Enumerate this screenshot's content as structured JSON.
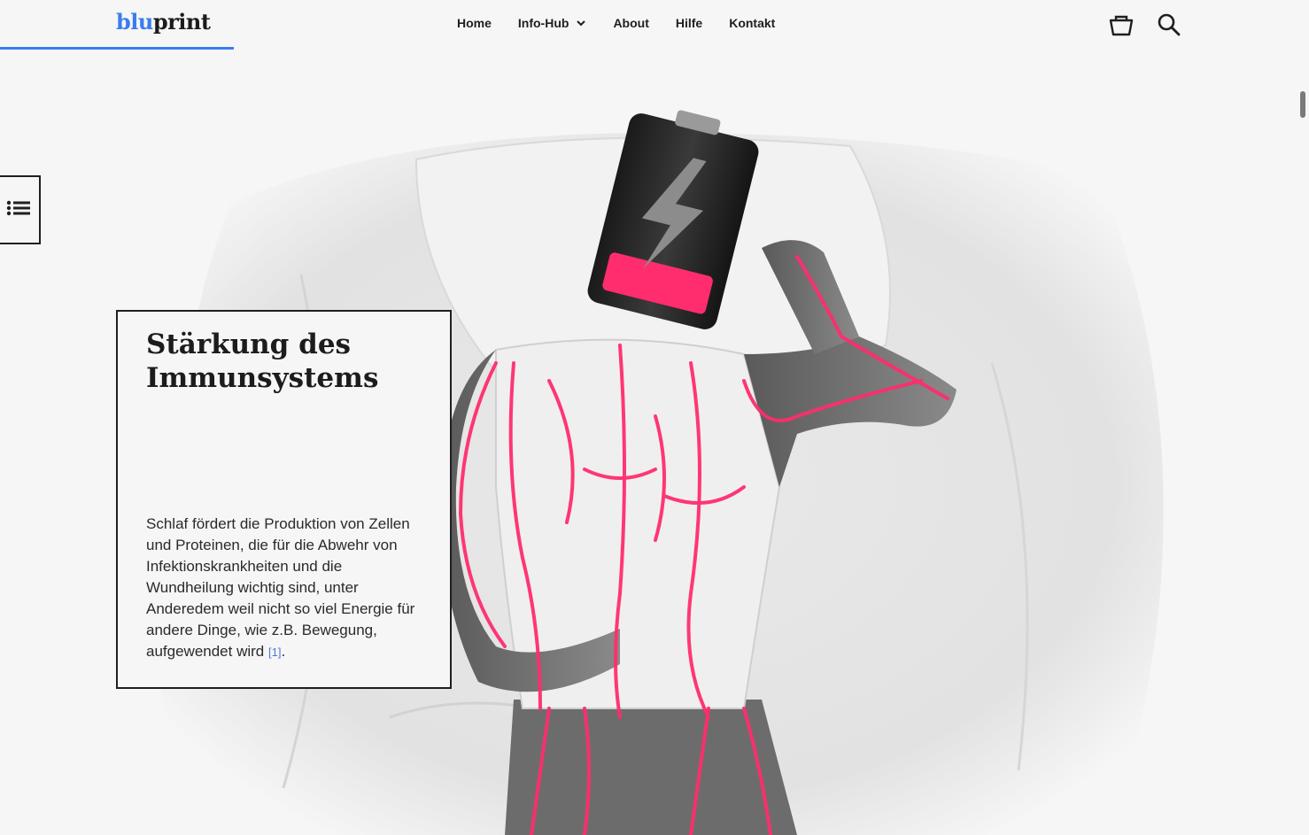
{
  "header": {
    "logo": {
      "part1": "blu",
      "part2": "print"
    },
    "reading_progress": 0.18,
    "nav": [
      {
        "label": "Home"
      },
      {
        "label": "Info-Hub",
        "has_dropdown": true
      },
      {
        "label": "About"
      },
      {
        "label": "Hilfe"
      },
      {
        "label": "Kontakt"
      }
    ],
    "icons": [
      "shopping-bag-icon",
      "search-icon"
    ]
  },
  "sidebar": {
    "toc_icon": "list-icon"
  },
  "section": {
    "title": "Stärkung des Immunsystems",
    "body": "Schlaf fördert die Produktion von Zellen und Proteinen, die für die Abwehr von Infektionskrankheiten und die Wundheilung wichtig sind, unter Anderedem weil nicht so viel Energie für andere Dinge, wie z.B. Bewegung, aufgewendet wird",
    "reference": "[1]",
    "after_reference": "."
  },
  "colors": {
    "accent": "#3b7cf0",
    "highlight": "#ff2d6e",
    "background": "#f6f6f6",
    "text": "#1c1c1c"
  }
}
